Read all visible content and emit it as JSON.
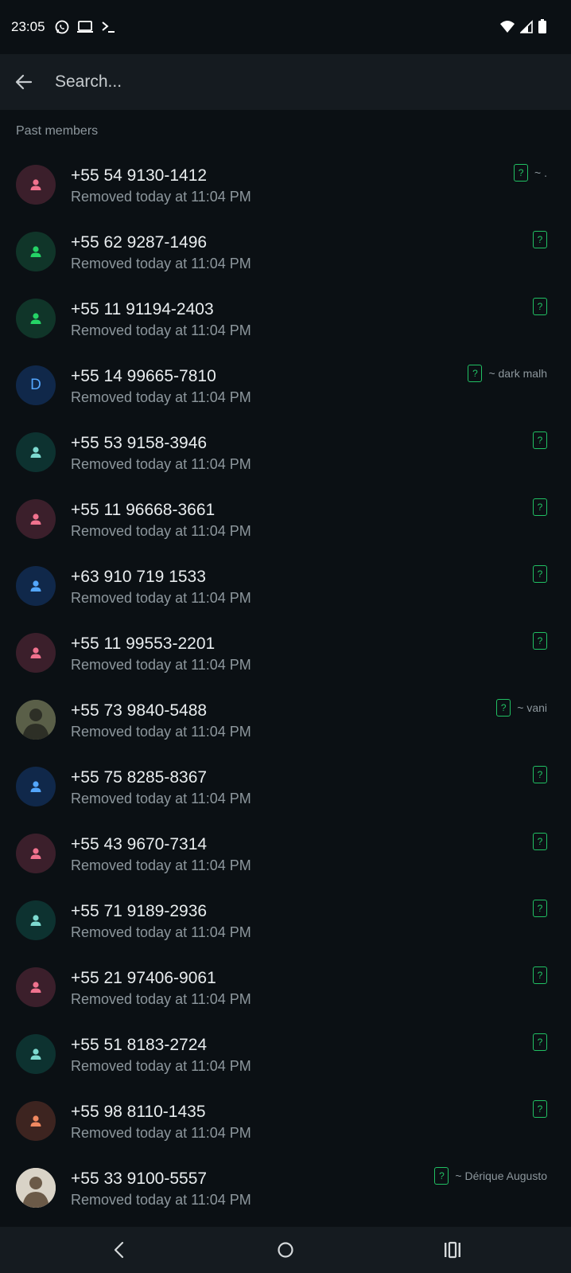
{
  "status_bar": {
    "time": "23:05",
    "left_icons": [
      "whatsapp-icon",
      "laptop-icon",
      "terminal-icon"
    ],
    "right_icons": [
      "wifi-icon",
      "signal-icon",
      "battery-icon"
    ]
  },
  "search": {
    "placeholder": "Search...",
    "value": ""
  },
  "section": {
    "title": "Past members"
  },
  "members": [
    {
      "phone": "+55 54 9130-1412",
      "status": "Removed today at 11:04 PM",
      "avatar": "person",
      "avatar_bg": "#3b1f2b",
      "avatar_fg": "#f0728e",
      "badge": "?",
      "push_name": "~ ."
    },
    {
      "phone": "+55 62 9287-1496",
      "status": "Removed today at 11:04 PM",
      "avatar": "person",
      "avatar_bg": "#103529",
      "avatar_fg": "#25d366",
      "badge": "?",
      "push_name": ""
    },
    {
      "phone": "+55 11 91194-2403",
      "status": "Removed today at 11:04 PM",
      "avatar": "person",
      "avatar_bg": "#103529",
      "avatar_fg": "#25d366",
      "badge": "?",
      "push_name": ""
    },
    {
      "phone": "+55 14 99665-7810",
      "status": "Removed today at 11:04 PM",
      "avatar": "letter",
      "letter": "D",
      "avatar_bg": "#10284a",
      "avatar_fg": "#53a6fd",
      "badge": "?",
      "push_name": "~ dark malh"
    },
    {
      "phone": "+55 53 9158-3946",
      "status": "Removed today at 11:04 PM",
      "avatar": "person",
      "avatar_bg": "#0d3230",
      "avatar_fg": "#7ddad0",
      "badge": "?",
      "push_name": ""
    },
    {
      "phone": "+55 11 96668-3661",
      "status": "Removed today at 11:04 PM",
      "avatar": "person",
      "avatar_bg": "#3b1f2b",
      "avatar_fg": "#f0728e",
      "badge": "?",
      "push_name": ""
    },
    {
      "phone": "+63 910 719 1533",
      "status": "Removed today at 11:04 PM",
      "avatar": "person",
      "avatar_bg": "#10284a",
      "avatar_fg": "#53a6fd",
      "badge": "?",
      "push_name": ""
    },
    {
      "phone": "+55 11 99553-2201",
      "status": "Removed today at 11:04 PM",
      "avatar": "person",
      "avatar_bg": "#3b1f2b",
      "avatar_fg": "#f0728e",
      "badge": "?",
      "push_name": ""
    },
    {
      "phone": "+55 73 9840-5488",
      "status": "Removed today at 11:04 PM",
      "avatar": "photo",
      "avatar_bg": "#5a5f48",
      "avatar_fg": "#2d2f26",
      "badge": "?",
      "push_name": "~ vani"
    },
    {
      "phone": "+55 75 8285-8367",
      "status": "Removed today at 11:04 PM",
      "avatar": "person",
      "avatar_bg": "#10284a",
      "avatar_fg": "#53a6fd",
      "badge": "?",
      "push_name": ""
    },
    {
      "phone": "+55 43 9670-7314",
      "status": "Removed today at 11:04 PM",
      "avatar": "person",
      "avatar_bg": "#3b1f2b",
      "avatar_fg": "#f0728e",
      "badge": "?",
      "push_name": ""
    },
    {
      "phone": "+55 71 9189-2936",
      "status": "Removed today at 11:04 PM",
      "avatar": "person",
      "avatar_bg": "#0d3230",
      "avatar_fg": "#7ddad0",
      "badge": "?",
      "push_name": ""
    },
    {
      "phone": "+55 21 97406-9061",
      "status": "Removed today at 11:04 PM",
      "avatar": "person",
      "avatar_bg": "#3b1f2b",
      "avatar_fg": "#f0728e",
      "badge": "?",
      "push_name": ""
    },
    {
      "phone": "+55 51 8183-2724",
      "status": "Removed today at 11:04 PM",
      "avatar": "person",
      "avatar_bg": "#0d3230",
      "avatar_fg": "#7ddad0",
      "badge": "?",
      "push_name": ""
    },
    {
      "phone": "+55 98 8110-1435",
      "status": "Removed today at 11:04 PM",
      "avatar": "person",
      "avatar_bg": "#3d2420",
      "avatar_fg": "#f08860",
      "badge": "?",
      "push_name": ""
    },
    {
      "phone": "+55 33 9100-5557",
      "status": "Removed today at 11:04 PM",
      "avatar": "photo",
      "avatar_bg": "#d9d3c7",
      "avatar_fg": "#6b5a48",
      "badge": "?",
      "push_name": "~ Dérique Augusto"
    }
  ],
  "nav_bar": {
    "buttons": [
      "back-nav-icon",
      "home-nav-icon",
      "recents-nav-icon"
    ]
  }
}
